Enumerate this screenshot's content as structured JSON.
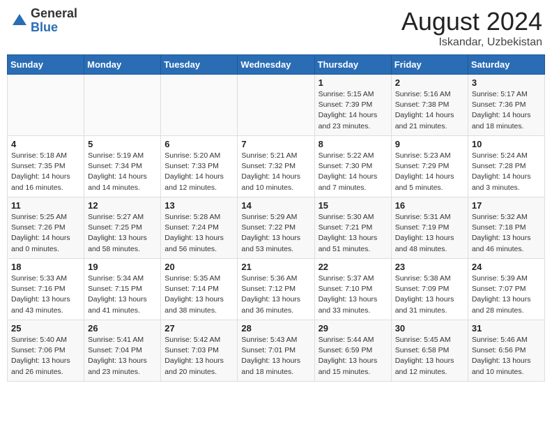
{
  "header": {
    "logo_general": "General",
    "logo_blue": "Blue",
    "month_title": "August 2024",
    "location": "Iskandar, Uzbekistan"
  },
  "weekdays": [
    "Sunday",
    "Monday",
    "Tuesday",
    "Wednesday",
    "Thursday",
    "Friday",
    "Saturday"
  ],
  "weeks": [
    [
      {
        "day": "",
        "info": ""
      },
      {
        "day": "",
        "info": ""
      },
      {
        "day": "",
        "info": ""
      },
      {
        "day": "",
        "info": ""
      },
      {
        "day": "1",
        "info": "Sunrise: 5:15 AM\nSunset: 7:39 PM\nDaylight: 14 hours and 23 minutes."
      },
      {
        "day": "2",
        "info": "Sunrise: 5:16 AM\nSunset: 7:38 PM\nDaylight: 14 hours and 21 minutes."
      },
      {
        "day": "3",
        "info": "Sunrise: 5:17 AM\nSunset: 7:36 PM\nDaylight: 14 hours and 18 minutes."
      }
    ],
    [
      {
        "day": "4",
        "info": "Sunrise: 5:18 AM\nSunset: 7:35 PM\nDaylight: 14 hours and 16 minutes."
      },
      {
        "day": "5",
        "info": "Sunrise: 5:19 AM\nSunset: 7:34 PM\nDaylight: 14 hours and 14 minutes."
      },
      {
        "day": "6",
        "info": "Sunrise: 5:20 AM\nSunset: 7:33 PM\nDaylight: 14 hours and 12 minutes."
      },
      {
        "day": "7",
        "info": "Sunrise: 5:21 AM\nSunset: 7:32 PM\nDaylight: 14 hours and 10 minutes."
      },
      {
        "day": "8",
        "info": "Sunrise: 5:22 AM\nSunset: 7:30 PM\nDaylight: 14 hours and 7 minutes."
      },
      {
        "day": "9",
        "info": "Sunrise: 5:23 AM\nSunset: 7:29 PM\nDaylight: 14 hours and 5 minutes."
      },
      {
        "day": "10",
        "info": "Sunrise: 5:24 AM\nSunset: 7:28 PM\nDaylight: 14 hours and 3 minutes."
      }
    ],
    [
      {
        "day": "11",
        "info": "Sunrise: 5:25 AM\nSunset: 7:26 PM\nDaylight: 14 hours and 0 minutes."
      },
      {
        "day": "12",
        "info": "Sunrise: 5:27 AM\nSunset: 7:25 PM\nDaylight: 13 hours and 58 minutes."
      },
      {
        "day": "13",
        "info": "Sunrise: 5:28 AM\nSunset: 7:24 PM\nDaylight: 13 hours and 56 minutes."
      },
      {
        "day": "14",
        "info": "Sunrise: 5:29 AM\nSunset: 7:22 PM\nDaylight: 13 hours and 53 minutes."
      },
      {
        "day": "15",
        "info": "Sunrise: 5:30 AM\nSunset: 7:21 PM\nDaylight: 13 hours and 51 minutes."
      },
      {
        "day": "16",
        "info": "Sunrise: 5:31 AM\nSunset: 7:19 PM\nDaylight: 13 hours and 48 minutes."
      },
      {
        "day": "17",
        "info": "Sunrise: 5:32 AM\nSunset: 7:18 PM\nDaylight: 13 hours and 46 minutes."
      }
    ],
    [
      {
        "day": "18",
        "info": "Sunrise: 5:33 AM\nSunset: 7:16 PM\nDaylight: 13 hours and 43 minutes."
      },
      {
        "day": "19",
        "info": "Sunrise: 5:34 AM\nSunset: 7:15 PM\nDaylight: 13 hours and 41 minutes."
      },
      {
        "day": "20",
        "info": "Sunrise: 5:35 AM\nSunset: 7:14 PM\nDaylight: 13 hours and 38 minutes."
      },
      {
        "day": "21",
        "info": "Sunrise: 5:36 AM\nSunset: 7:12 PM\nDaylight: 13 hours and 36 minutes."
      },
      {
        "day": "22",
        "info": "Sunrise: 5:37 AM\nSunset: 7:10 PM\nDaylight: 13 hours and 33 minutes."
      },
      {
        "day": "23",
        "info": "Sunrise: 5:38 AM\nSunset: 7:09 PM\nDaylight: 13 hours and 31 minutes."
      },
      {
        "day": "24",
        "info": "Sunrise: 5:39 AM\nSunset: 7:07 PM\nDaylight: 13 hours and 28 minutes."
      }
    ],
    [
      {
        "day": "25",
        "info": "Sunrise: 5:40 AM\nSunset: 7:06 PM\nDaylight: 13 hours and 26 minutes."
      },
      {
        "day": "26",
        "info": "Sunrise: 5:41 AM\nSunset: 7:04 PM\nDaylight: 13 hours and 23 minutes."
      },
      {
        "day": "27",
        "info": "Sunrise: 5:42 AM\nSunset: 7:03 PM\nDaylight: 13 hours and 20 minutes."
      },
      {
        "day": "28",
        "info": "Sunrise: 5:43 AM\nSunset: 7:01 PM\nDaylight: 13 hours and 18 minutes."
      },
      {
        "day": "29",
        "info": "Sunrise: 5:44 AM\nSunset: 6:59 PM\nDaylight: 13 hours and 15 minutes."
      },
      {
        "day": "30",
        "info": "Sunrise: 5:45 AM\nSunset: 6:58 PM\nDaylight: 13 hours and 12 minutes."
      },
      {
        "day": "31",
        "info": "Sunrise: 5:46 AM\nSunset: 6:56 PM\nDaylight: 13 hours and 10 minutes."
      }
    ]
  ]
}
